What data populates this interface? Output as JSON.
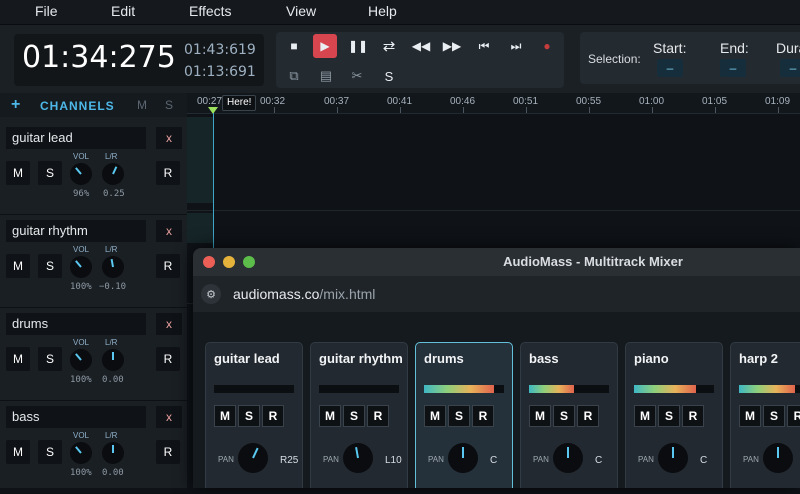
{
  "menu": [
    "File",
    "Edit",
    "Effects",
    "View",
    "Help"
  ],
  "time": {
    "current": "01:34:275",
    "total": "01:43:619",
    "remaining": "01:13:691"
  },
  "transport": {
    "edit_s_label": "S"
  },
  "selection": {
    "label": "Selection:",
    "start_label": "Start:",
    "end_label": "End:",
    "dur_label": "Dura",
    "start_val": "–",
    "end_val": "–",
    "dur_val": "–"
  },
  "sidebar": {
    "title": "CHANNELS",
    "add": "+",
    "m": "M",
    "s": "S",
    "vol_label": "VOL",
    "lr_label": "L/R",
    "m_btn": "M",
    "s_btn": "S",
    "r_btn": "R",
    "x_btn": "x"
  },
  "channels": [
    {
      "name": "guitar lead",
      "vol": "96%",
      "lr": "0.25"
    },
    {
      "name": "guitar rhythm",
      "vol": "100%",
      "lr": "−0.10"
    },
    {
      "name": "drums",
      "vol": "100%",
      "lr": "0.00"
    },
    {
      "name": "bass",
      "vol": "100%",
      "lr": "0.00"
    }
  ],
  "ruler": [
    "00:27",
    "00:32",
    "00:37",
    "00:41",
    "00:46",
    "00:51",
    "00:55",
    "01:00",
    "01:05",
    "01:09"
  ],
  "marker": "Here!",
  "window": {
    "title": "AudioMass - Multitrack Mixer",
    "url_host": "audiomass.co",
    "url_path": "/mix.html"
  },
  "mixer": {
    "pan_label": "PAN",
    "m": "M",
    "s": "S",
    "r": "R",
    "strips": [
      {
        "name": "guitar lead",
        "pan": "R25",
        "level": 0
      },
      {
        "name": "guitar rhythm",
        "pan": "L10",
        "level": 0
      },
      {
        "name": "drums",
        "pan": "C",
        "level": 0.88
      },
      {
        "name": "bass",
        "pan": "C",
        "level": 0.56
      },
      {
        "name": "piano",
        "pan": "C",
        "level": 0.78
      },
      {
        "name": "harp 2",
        "pan": "C",
        "level": 0.7
      }
    ]
  },
  "colors": {
    "accent": "#4db8e8",
    "play": "#d7464f",
    "record": "#c43c3c"
  }
}
